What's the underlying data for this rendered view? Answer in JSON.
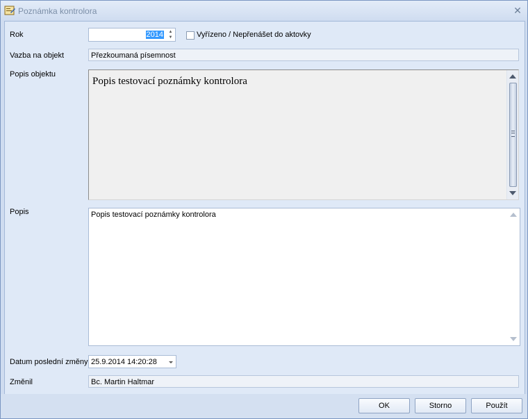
{
  "window": {
    "title": "Poznámka kontrolora",
    "close_glyph": "✕"
  },
  "form": {
    "rok_label": "Rok",
    "rok_value": "2014",
    "checkbox_label": "Vyřízeno / Nepřenášet do aktovky",
    "checkbox_checked": false,
    "vazba_label": "Vazba na objekt",
    "vazba_value": "Přezkoumaná písemnost",
    "popis_objektu_label": "Popis objektu",
    "popis_objektu_value": "Popis testovací poznámky kontrolora",
    "popis_label": "Popis",
    "popis_value": "Popis testovací poznámky kontrolora",
    "datum_label": "Datum poslední změny",
    "datum_value": "25.9.2014 14:20:28",
    "zmenil_label": "Změnil",
    "zmenil_value": "Bc. Martin Haltmar"
  },
  "buttons": {
    "ok": "OK",
    "storno": "Storno",
    "pouzit": "Použít"
  },
  "icons": [
    "app-icon",
    "close-icon",
    "spin-up-icon",
    "spin-down-icon",
    "scroll-up-icon",
    "scroll-down-icon",
    "dropdown-arrow-icon"
  ]
}
